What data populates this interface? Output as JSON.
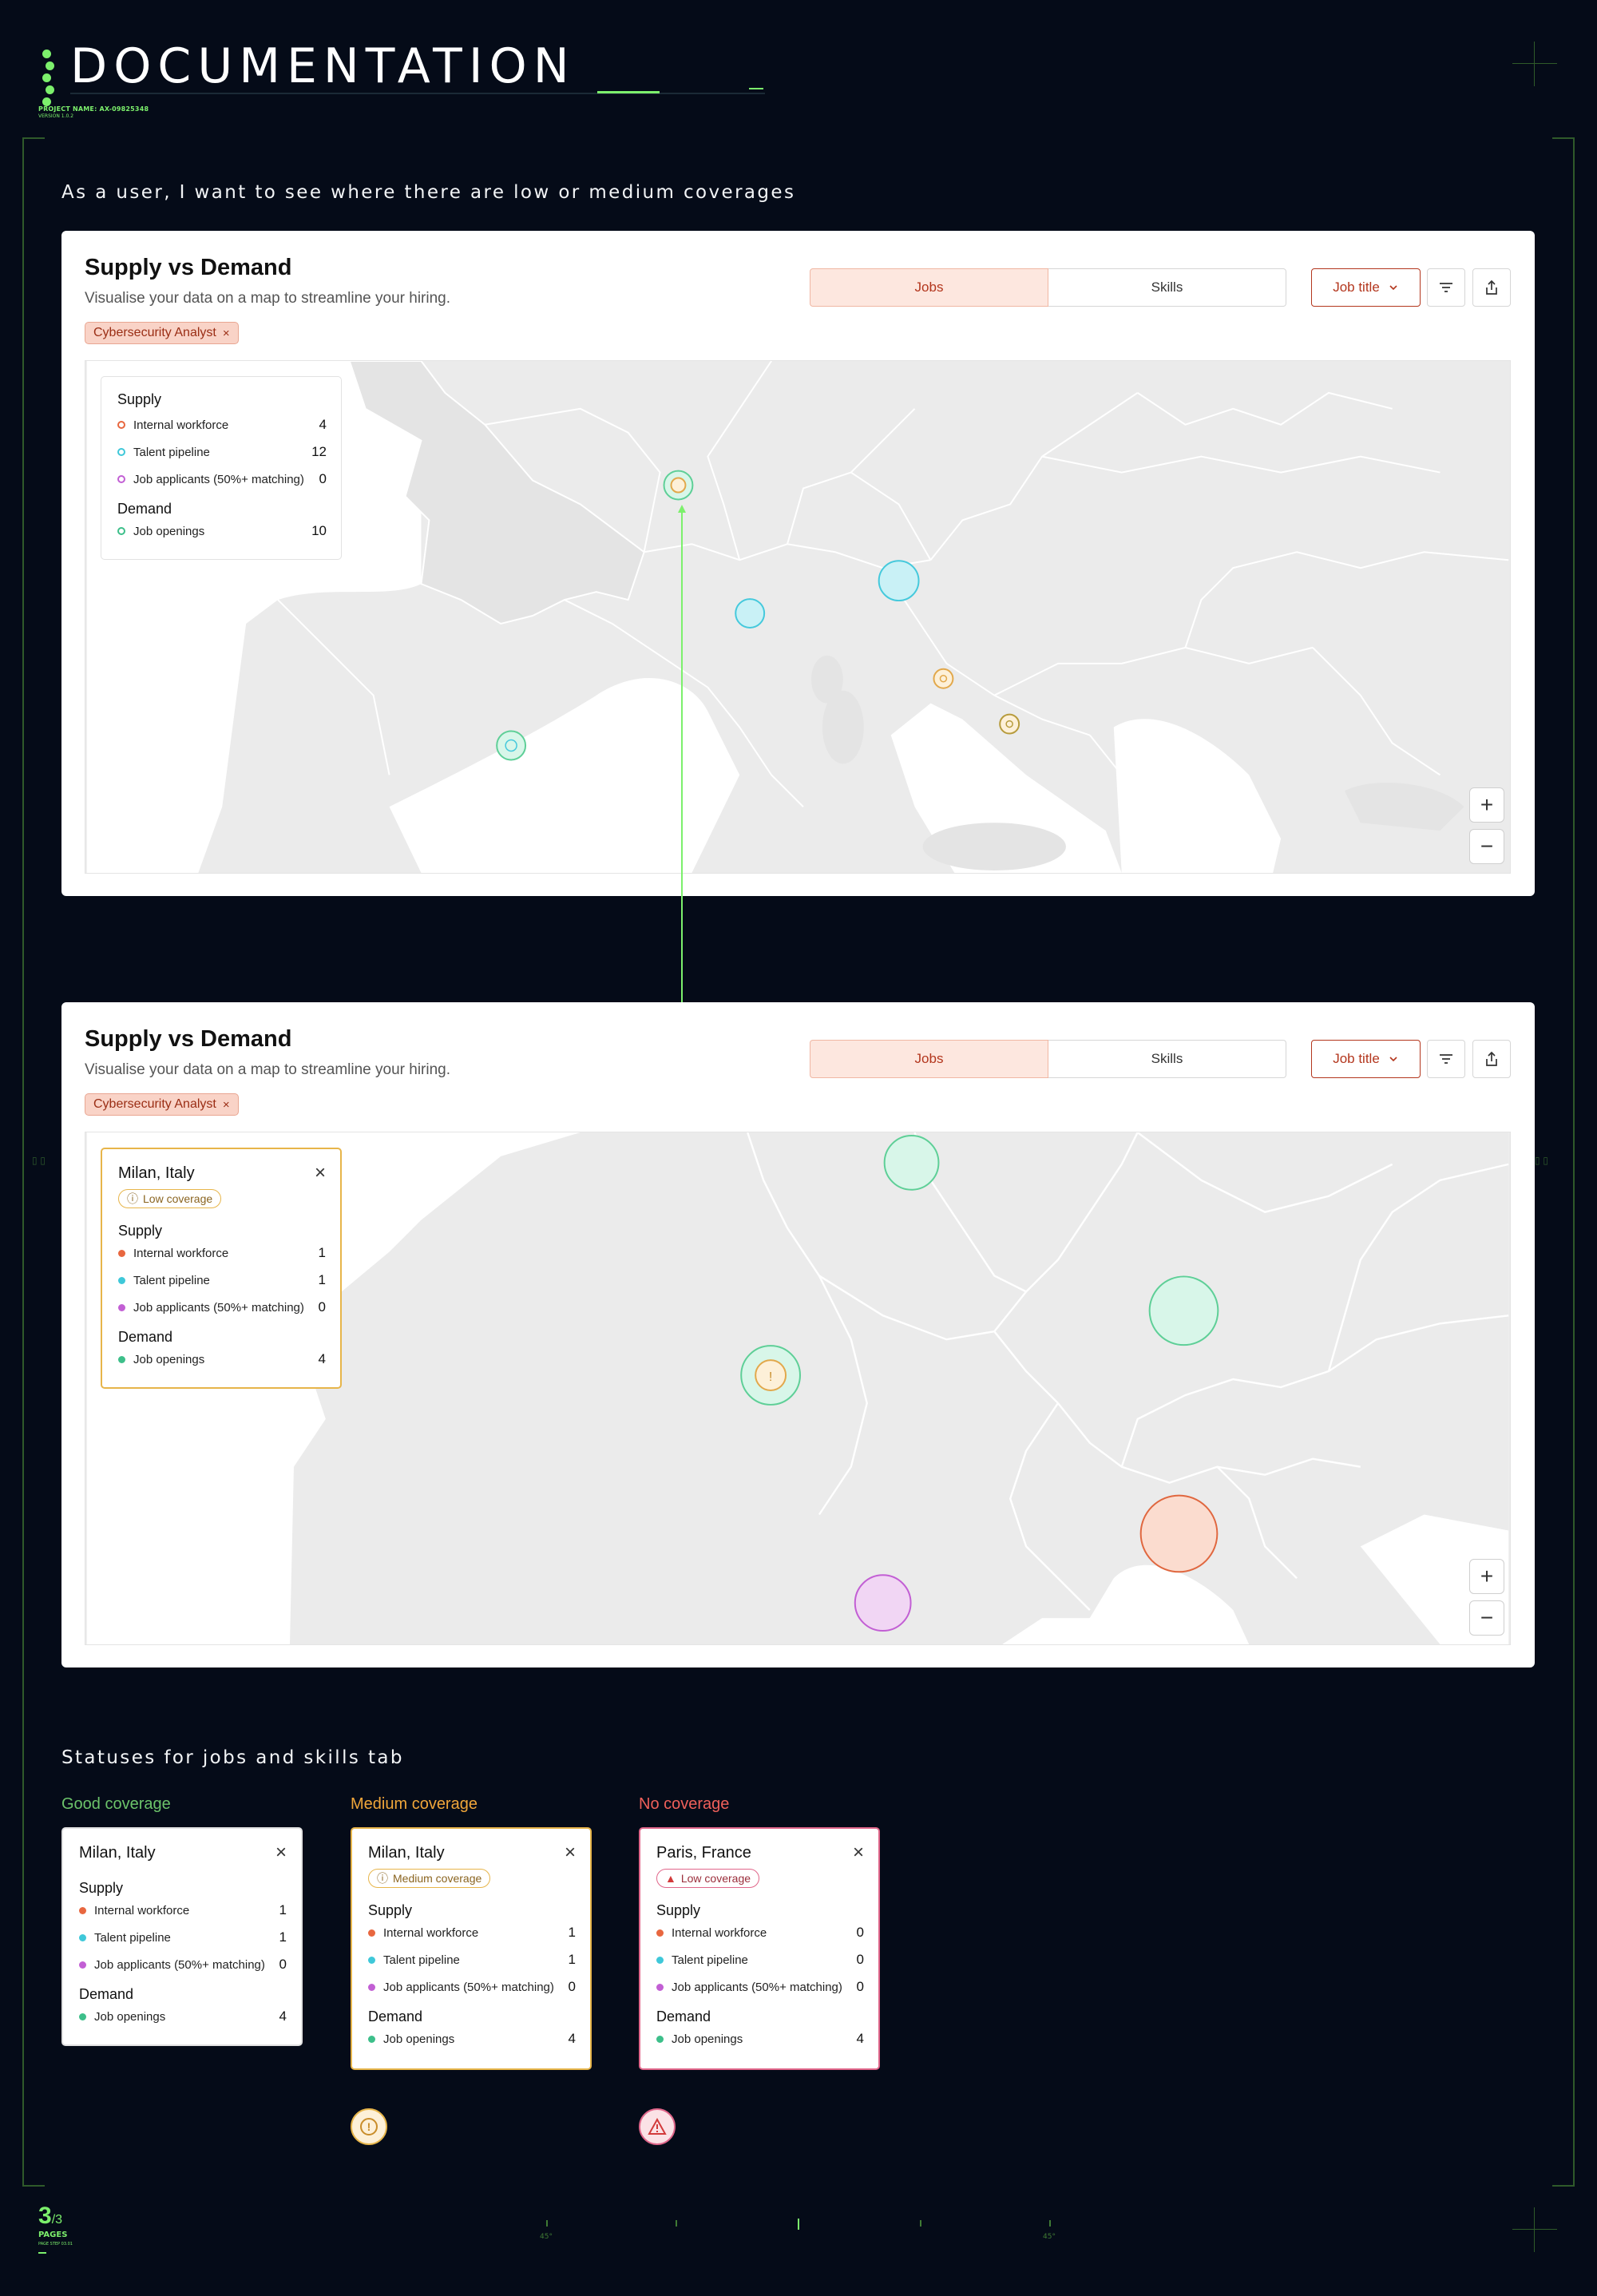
{
  "header": {
    "title": "DOCUMENTATION",
    "project_name": "PROJECT NAME: AX-09825348",
    "project_sub": "VERSION 1.0.2",
    "accent": "#7cf06c"
  },
  "section1": {
    "heading": "As a user, I want to see where there are low or medium coverages"
  },
  "panel": {
    "title": "Supply vs Demand",
    "subtitle": "Visualise your data on a map to streamline your hiring.",
    "tabs": [
      "Jobs",
      "Skills"
    ],
    "dropdown_label": "Job title",
    "filter_icon": "filter-icon",
    "export_icon": "share-icon",
    "chip_label": "Cybersecurity Analyst",
    "chip_close": "×",
    "zoom_in": "+",
    "zoom_out": "−"
  },
  "legend": {
    "supply_heading": "Supply",
    "demand_heading": "Demand",
    "rows": [
      {
        "label": "Internal workforce",
        "value": "4",
        "color": "#e8673f"
      },
      {
        "label": "Talent pipeline",
        "value": "12",
        "color": "#3fc8d9"
      },
      {
        "label": "Job applicants (50%+ matching)",
        "value": "0",
        "color": "#c25fd4"
      }
    ],
    "demand_rows": [
      {
        "label": "Job openings",
        "value": "10",
        "color": "#3dbf8a"
      }
    ]
  },
  "milan_card": {
    "title": "Milan, Italy",
    "badge": "Low coverage",
    "supply_heading": "Supply",
    "demand_heading": "Demand",
    "rows": [
      {
        "label": "Internal workforce",
        "value": "1"
      },
      {
        "label": "Talent pipeline",
        "value": "1"
      },
      {
        "label": "Job applicants (50%+ matching)",
        "value": "0"
      }
    ],
    "demand_rows": [
      {
        "label": "Job openings",
        "value": "4"
      }
    ]
  },
  "section2": {
    "heading": "Statuses for jobs and skills tab",
    "statuses": [
      {
        "label": "Good coverage",
        "label_color": "#6cc36a",
        "card_title": "Milan, Italy",
        "badge": "",
        "border": "#e2e2e2",
        "rows": [
          {
            "label": "Internal workforce",
            "value": "1"
          },
          {
            "label": "Talent pipeline",
            "value": "1"
          },
          {
            "label": "Job applicants (50%+ matching)",
            "value": "0"
          }
        ],
        "demand_rows": [
          {
            "label": "Job openings",
            "value": "4"
          }
        ]
      },
      {
        "label": "Medium coverage",
        "label_color": "#f0a63a",
        "card_title": "Milan, Italy",
        "badge": "Medium coverage",
        "border": "#e7b54a",
        "rows": [
          {
            "label": "Internal workforce",
            "value": "1"
          },
          {
            "label": "Talent pipeline",
            "value": "1"
          },
          {
            "label": "Job applicants (50%+ matching)",
            "value": "0"
          }
        ],
        "demand_rows": [
          {
            "label": "Job openings",
            "value": "4"
          }
        ]
      },
      {
        "label": "No coverage",
        "label_color": "#f0605a",
        "card_title": "Paris, France",
        "badge": "Low coverage",
        "border": "#e0668a",
        "rows": [
          {
            "label": "Internal workforce",
            "value": "0"
          },
          {
            "label": "Talent pipeline",
            "value": "0"
          },
          {
            "label": "Job applicants (50%+ matching)",
            "value": "0"
          }
        ],
        "demand_rows": [
          {
            "label": "Job openings",
            "value": "4"
          }
        ]
      }
    ],
    "supply_heading": "Supply",
    "demand_heading": "Demand"
  },
  "footer": {
    "page_current": "3",
    "page_total": "/3",
    "pages_label": "PAGES",
    "pages_sub": "PAGE STEP 03.01",
    "angle_left": "45°",
    "angle_right": "45°"
  }
}
